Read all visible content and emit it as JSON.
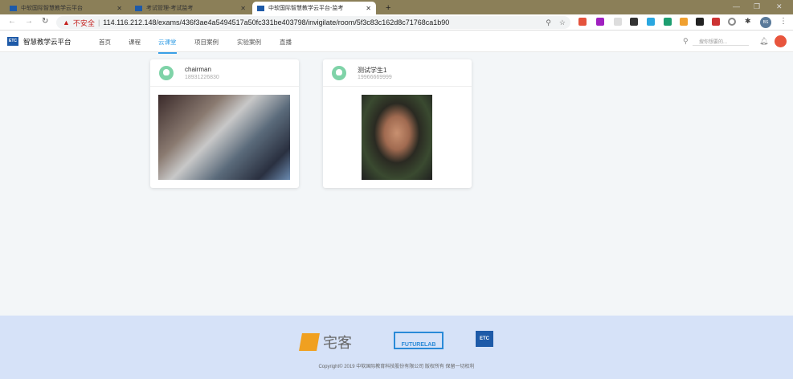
{
  "browser": {
    "tabs": [
      {
        "label": "中软国际智慧教学云平台",
        "active": false
      },
      {
        "label": "考试管理-考试监考",
        "active": false
      },
      {
        "label": "中软国际智慧教学云平台-监考",
        "active": true
      }
    ],
    "security_label": "不安全",
    "url": "114.116.212.148/exams/436f3ae4a5494517a50fc331be403798/invigilate/room/5f3c83c162d8c71768ca1b90",
    "profile_initial": "BS"
  },
  "site": {
    "logo_text": "ETC",
    "brand": "智慧教学云平台",
    "nav": [
      {
        "label": "首页"
      },
      {
        "label": "课程"
      },
      {
        "label": "云课堂",
        "active": true
      },
      {
        "label": "项目案例"
      },
      {
        "label": "实验案例"
      },
      {
        "label": "直播"
      }
    ],
    "search_placeholder": "搜你想要的..."
  },
  "students": [
    {
      "name": "chairman",
      "phone": "18931226830"
    },
    {
      "name": "测试学生1",
      "phone": "19966669999"
    }
  ],
  "footer": {
    "partners": [
      "宅客",
      "FUTURELAB",
      "ETC"
    ],
    "copyright": "Copyright© 2019 中软国际教育科技股份有限公司 版权所有 保留一切权利"
  },
  "colors": {
    "accent": "#3aa0e6",
    "footer_bg": "#d6e2f8",
    "tabbar": "#8b7f58"
  }
}
